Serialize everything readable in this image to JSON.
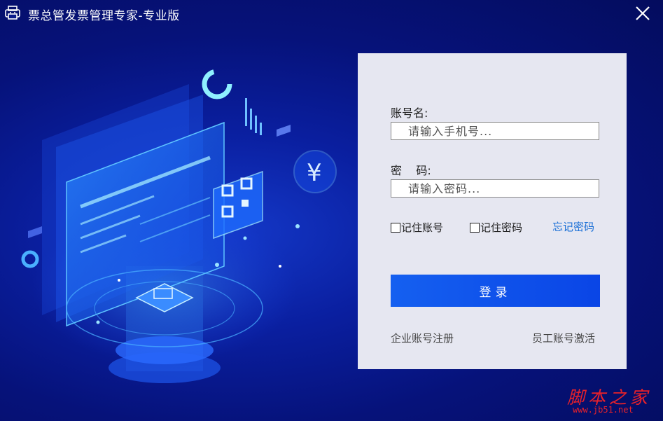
{
  "window": {
    "title": "票总管发票管理专家-专业版",
    "icon": "printer-icon",
    "close_icon": "close-icon"
  },
  "login": {
    "account_label": "账号名:",
    "account_placeholder": "请输入手机号...",
    "password_label": "密    码:",
    "password_placeholder": "请输入密码...",
    "remember_account": "记住账号",
    "remember_password": "记住密码",
    "forgot_password": "忘记密码",
    "login_button": "登录",
    "register_link": "企业账号注册",
    "activate_link": "员工账号激活"
  },
  "illustration": {
    "currency_symbol": "¥"
  },
  "watermark": {
    "text": "脚本之家",
    "url": "www.jb51.net"
  },
  "colors": {
    "background": "#06127a",
    "panel": "#e6e7f1",
    "accent": "#1560f0",
    "link": "#1a6fd6",
    "watermark": "#e8212a"
  }
}
